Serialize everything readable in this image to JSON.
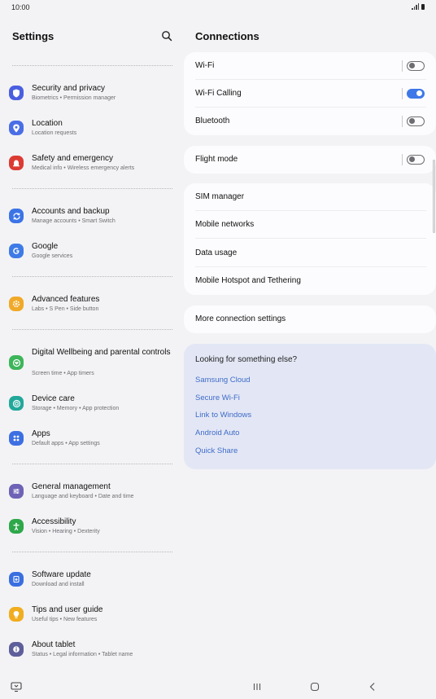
{
  "status_bar": {
    "time": "10:00"
  },
  "left_pane": {
    "title": "Settings",
    "items": [
      {
        "title": "Security and privacy",
        "subtitle": "Biometrics  •  Permission manager",
        "icon": "shield-icon",
        "color": "#4a5fe0"
      },
      {
        "title": "Location",
        "subtitle": "Location requests",
        "icon": "location-pin-icon",
        "color": "#4a6ee6"
      },
      {
        "title": "Safety and emergency",
        "subtitle": "Medical info  •  Wireless emergency alerts",
        "icon": "emergency-icon",
        "color": "#dc3b33"
      },
      {
        "title": "Accounts and backup",
        "subtitle": "Manage accounts  •  Smart Switch",
        "icon": "sync-icon",
        "color": "#3c74e6"
      },
      {
        "title": "Google",
        "subtitle": "Google services",
        "icon": "google-icon",
        "color": "#3f7be6"
      },
      {
        "title": "Advanced features",
        "subtitle": "Labs  •  S Pen  •  Side button",
        "icon": "gear-plus-icon",
        "color": "#f0a928"
      },
      {
        "title": "Digital Wellbeing and parental controls",
        "subtitle": "Screen time  •  App timers",
        "icon": "wellbeing-icon",
        "color": "#3db55a"
      },
      {
        "title": "Device care",
        "subtitle": "Storage  •  Memory  •  App protection",
        "icon": "device-care-icon",
        "color": "#22a89a"
      },
      {
        "title": "Apps",
        "subtitle": "Default apps  •  App settings",
        "icon": "apps-grid-icon",
        "color": "#3d6fe3"
      },
      {
        "title": "General management",
        "subtitle": "Language and keyboard  •  Date and time",
        "icon": "sliders-icon",
        "color": "#6d62b5"
      },
      {
        "title": "Accessibility",
        "subtitle": "Vision  •  Hearing  •  Dexterity",
        "icon": "accessibility-icon",
        "color": "#2ea84a"
      },
      {
        "title": "Software update",
        "subtitle": "Download and install",
        "icon": "software-update-icon",
        "color": "#3b6fe0"
      },
      {
        "title": "Tips and user guide",
        "subtitle": "Useful tips  •  New features",
        "icon": "lightbulb-icon",
        "color": "#f1ad20"
      },
      {
        "title": "About tablet",
        "subtitle": "Status  •  Legal information  •  Tablet name",
        "icon": "info-icon",
        "color": "#5e5e9a"
      }
    ]
  },
  "right_pane": {
    "title": "Connections",
    "group1": [
      {
        "label": "Wi-Fi",
        "toggle_on": false
      },
      {
        "label": "Wi-Fi Calling",
        "toggle_on": true
      },
      {
        "label": "Bluetooth",
        "toggle_on": false
      }
    ],
    "group2": [
      {
        "label": "Flight mode",
        "toggle_on": false
      }
    ],
    "group3": [
      {
        "label": "SIM manager"
      },
      {
        "label": "Mobile networks"
      },
      {
        "label": "Data usage"
      },
      {
        "label": "Mobile Hotspot and Tethering"
      }
    ],
    "group4": [
      {
        "label": "More connection settings"
      }
    ],
    "suggestions": {
      "title": "Looking for something else?",
      "links": [
        "Samsung Cloud",
        "Secure Wi-Fi",
        "Link to Windows",
        "Android Auto",
        "Quick Share"
      ]
    }
  },
  "colors": {
    "accent": "#3e78e8",
    "link": "#3f6bc8",
    "suggest_bg": "#e3e7f5",
    "background": "#f3f3f5"
  }
}
